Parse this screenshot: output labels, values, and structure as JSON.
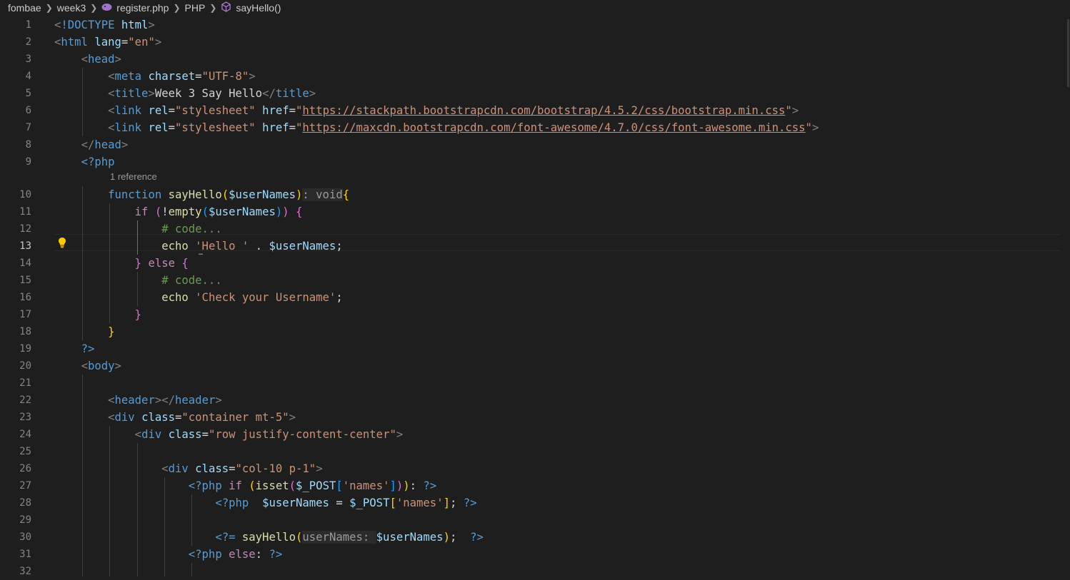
{
  "breadcrumb": {
    "items": [
      "fombae",
      "week3",
      "register.php",
      "PHP",
      "sayHello()"
    ],
    "icons": {
      "file": "php-elephant-icon",
      "symbol": "method-cube-icon",
      "separator": "chevron-right-icon"
    }
  },
  "editor": {
    "active_line": 13,
    "codelens": "1 reference",
    "line_numbers": [
      "1",
      "2",
      "3",
      "4",
      "5",
      "6",
      "7",
      "8",
      "9",
      "10",
      "11",
      "12",
      "13",
      "14",
      "15",
      "16",
      "17",
      "18",
      "19",
      "20",
      "21",
      "22",
      "23",
      "24",
      "25",
      "26",
      "27",
      "28",
      "29",
      "30",
      "31",
      "32"
    ],
    "lines": [
      [
        [
          "p",
          "<"
        ],
        [
          "t",
          "!DOCTYPE"
        ],
        [
          "tx",
          " "
        ],
        [
          "a",
          "html"
        ],
        [
          "p",
          ">"
        ]
      ],
      [
        [
          "p",
          "<"
        ],
        [
          "t",
          "html"
        ],
        [
          "tx",
          " "
        ],
        [
          "a",
          "lang"
        ],
        [
          "tx",
          "="
        ],
        [
          "s",
          "\"en\""
        ],
        [
          "p",
          ">"
        ]
      ],
      [
        [
          "tx",
          "    "
        ],
        [
          "p",
          "<"
        ],
        [
          "t",
          "head"
        ],
        [
          "p",
          ">"
        ]
      ],
      [
        [
          "tx",
          "        "
        ],
        [
          "p",
          "<"
        ],
        [
          "t",
          "meta"
        ],
        [
          "tx",
          " "
        ],
        [
          "a",
          "charset"
        ],
        [
          "tx",
          "="
        ],
        [
          "s",
          "\"UTF-8\""
        ],
        [
          "p",
          ">"
        ]
      ],
      [
        [
          "tx",
          "        "
        ],
        [
          "p",
          "<"
        ],
        [
          "t",
          "title"
        ],
        [
          "p",
          ">"
        ],
        [
          "tx",
          "Week 3 Say Hello"
        ],
        [
          "p",
          "</"
        ],
        [
          "t",
          "title"
        ],
        [
          "p",
          ">"
        ]
      ],
      [
        [
          "tx",
          "        "
        ],
        [
          "p",
          "<"
        ],
        [
          "t",
          "link"
        ],
        [
          "tx",
          " "
        ],
        [
          "a",
          "rel"
        ],
        [
          "tx",
          "="
        ],
        [
          "s",
          "\"stylesheet\""
        ],
        [
          "tx",
          " "
        ],
        [
          "a",
          "href"
        ],
        [
          "tx",
          "="
        ],
        [
          "s",
          "\""
        ],
        [
          "u",
          "https://stackpath.bootstrapcdn.com/bootstrap/4.5.2/css/bootstrap.min.css"
        ],
        [
          "s",
          "\""
        ],
        [
          "p",
          ">"
        ]
      ],
      [
        [
          "tx",
          "        "
        ],
        [
          "p",
          "<"
        ],
        [
          "t",
          "link"
        ],
        [
          "tx",
          " "
        ],
        [
          "a",
          "rel"
        ],
        [
          "tx",
          "="
        ],
        [
          "s",
          "\"stylesheet\""
        ],
        [
          "tx",
          " "
        ],
        [
          "a",
          "href"
        ],
        [
          "tx",
          "="
        ],
        [
          "s",
          "\""
        ],
        [
          "u",
          "https://maxcdn.bootstrapcdn.com/font-awesome/4.7.0/css/font-awesome.min.css"
        ],
        [
          "s",
          "\""
        ],
        [
          "p",
          ">"
        ]
      ],
      [
        [
          "tx",
          "    "
        ],
        [
          "p",
          "</"
        ],
        [
          "t",
          "head"
        ],
        [
          "p",
          ">"
        ]
      ],
      [
        [
          "tx",
          "    "
        ],
        [
          "t",
          "<?php"
        ]
      ],
      [
        [
          "tx",
          "        "
        ],
        [
          "k",
          "function"
        ],
        [
          "tx",
          " "
        ],
        [
          "f",
          "sayHello"
        ],
        [
          "b1",
          "("
        ],
        [
          "v",
          "$userNames"
        ],
        [
          "b1",
          ")"
        ],
        [
          "hint",
          ": void"
        ],
        [
          "b1",
          "{"
        ]
      ],
      [
        [
          "tx",
          "            "
        ],
        [
          "c",
          "if"
        ],
        [
          "tx",
          " "
        ],
        [
          "b2",
          "("
        ],
        [
          "tx",
          "!"
        ],
        [
          "f",
          "empty"
        ],
        [
          "b3",
          "("
        ],
        [
          "v",
          "$userNames"
        ],
        [
          "b3",
          ")"
        ],
        [
          "b2",
          ")"
        ],
        [
          "tx",
          " "
        ],
        [
          "b2",
          "{"
        ]
      ],
      [
        [
          "tx",
          "                "
        ],
        [
          "cm",
          "# code..."
        ]
      ],
      [
        [
          "tx",
          "                "
        ],
        [
          "f",
          "echo"
        ],
        [
          "tx",
          " "
        ],
        [
          "s",
          "'Hello '"
        ],
        [
          "tx",
          " . "
        ],
        [
          "v",
          "$userNames"
        ],
        [
          "tx",
          ";"
        ]
      ],
      [
        [
          "tx",
          "            "
        ],
        [
          "b2",
          "}"
        ],
        [
          "tx",
          " "
        ],
        [
          "c",
          "else"
        ],
        [
          "tx",
          " "
        ],
        [
          "b2",
          "{"
        ]
      ],
      [
        [
          "tx",
          "                "
        ],
        [
          "cm",
          "# code..."
        ]
      ],
      [
        [
          "tx",
          "                "
        ],
        [
          "f",
          "echo"
        ],
        [
          "tx",
          " "
        ],
        [
          "s",
          "'Check your Username'"
        ],
        [
          "tx",
          ";"
        ]
      ],
      [
        [
          "tx",
          "            "
        ],
        [
          "b2",
          "}"
        ]
      ],
      [
        [
          "tx",
          "        "
        ],
        [
          "b1",
          "}"
        ]
      ],
      [
        [
          "tx",
          "    "
        ],
        [
          "t",
          "?>"
        ]
      ],
      [
        [
          "tx",
          "    "
        ],
        [
          "p",
          "<"
        ],
        [
          "t",
          "body"
        ],
        [
          "p",
          ">"
        ]
      ],
      [],
      [
        [
          "tx",
          "        "
        ],
        [
          "p",
          "<"
        ],
        [
          "t",
          "header"
        ],
        [
          "p",
          "></"
        ],
        [
          "t",
          "header"
        ],
        [
          "p",
          ">"
        ]
      ],
      [
        [
          "tx",
          "        "
        ],
        [
          "p",
          "<"
        ],
        [
          "t",
          "div"
        ],
        [
          "tx",
          " "
        ],
        [
          "a",
          "class"
        ],
        [
          "tx",
          "="
        ],
        [
          "s",
          "\"container mt-5\""
        ],
        [
          "p",
          ">"
        ]
      ],
      [
        [
          "tx",
          "            "
        ],
        [
          "p",
          "<"
        ],
        [
          "t",
          "div"
        ],
        [
          "tx",
          " "
        ],
        [
          "a",
          "class"
        ],
        [
          "tx",
          "="
        ],
        [
          "s",
          "\"row justify-content-center\""
        ],
        [
          "p",
          ">"
        ]
      ],
      [],
      [
        [
          "tx",
          "                "
        ],
        [
          "p",
          "<"
        ],
        [
          "t",
          "div"
        ],
        [
          "tx",
          " "
        ],
        [
          "a",
          "class"
        ],
        [
          "tx",
          "="
        ],
        [
          "s",
          "\"col-10 p-1\""
        ],
        [
          "p",
          ">"
        ]
      ],
      [
        [
          "tx",
          "                    "
        ],
        [
          "t",
          "<?php"
        ],
        [
          "tx",
          " "
        ],
        [
          "c",
          "if"
        ],
        [
          "tx",
          " "
        ],
        [
          "b1",
          "("
        ],
        [
          "f",
          "isset"
        ],
        [
          "b2",
          "("
        ],
        [
          "v",
          "$_POST"
        ],
        [
          "b3",
          "["
        ],
        [
          "s",
          "'names'"
        ],
        [
          "b3",
          "]"
        ],
        [
          "b2",
          ")"
        ],
        [
          "b1",
          ")"
        ],
        [
          "tx",
          ": "
        ],
        [
          "t",
          "?>"
        ]
      ],
      [
        [
          "tx",
          "                        "
        ],
        [
          "t",
          "<?php"
        ],
        [
          "tx",
          "  "
        ],
        [
          "v",
          "$userNames"
        ],
        [
          "tx",
          " = "
        ],
        [
          "v",
          "$_POST"
        ],
        [
          "b1",
          "["
        ],
        [
          "s",
          "'names'"
        ],
        [
          "b1",
          "]"
        ],
        [
          "tx",
          "; "
        ],
        [
          "t",
          "?>"
        ]
      ],
      [],
      [
        [
          "tx",
          "                        "
        ],
        [
          "t",
          "<?="
        ],
        [
          "tx",
          " "
        ],
        [
          "f",
          "sayHello"
        ],
        [
          "b1",
          "("
        ],
        [
          "hint",
          "userNames: "
        ],
        [
          "v",
          "$userNames"
        ],
        [
          "b1",
          ")"
        ],
        [
          "tx",
          ";  "
        ],
        [
          "t",
          "?>"
        ]
      ],
      [
        [
          "tx",
          "                    "
        ],
        [
          "t",
          "<?php"
        ],
        [
          "tx",
          " "
        ],
        [
          "c",
          "else"
        ],
        [
          "tx",
          ": "
        ],
        [
          "t",
          "?>"
        ]
      ],
      []
    ]
  }
}
